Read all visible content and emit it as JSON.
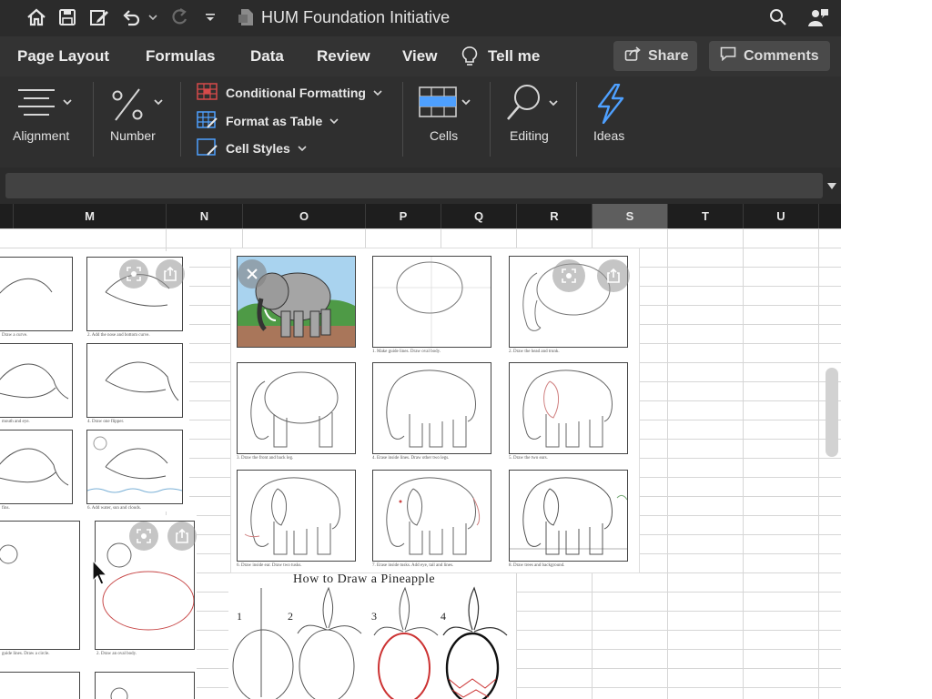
{
  "window": {
    "title": "HUM Foundation Initiative"
  },
  "tabs": [
    "Page Layout",
    "Formulas",
    "Data",
    "Review",
    "View",
    "Tell me"
  ],
  "header_buttons": {
    "share": "Share",
    "comments": "Comments"
  },
  "ribbon": {
    "alignment": "Alignment",
    "number": "Number",
    "styles": [
      "Conditional Formatting",
      "Format as Table",
      "Cell Styles"
    ],
    "cells": "Cells",
    "editing": "Editing",
    "ideas": "Ideas"
  },
  "formula_bar": {
    "value": ""
  },
  "columns": [
    "M",
    "N",
    "O",
    "P",
    "Q",
    "R",
    "S",
    "T",
    "U"
  ],
  "selected_column": "S",
  "pineapple": {
    "title": "How to Draw a Pineapple",
    "steps": [
      "1",
      "2",
      "3",
      "4"
    ]
  },
  "elephant_captions": [
    "1. Make guide lines. Draw oval body.",
    "2. Draw the head and trunk.",
    "3. Draw the front and back leg.",
    "4. Erase inside lines. Draw other two legs.",
    "5. Draw the two ears.",
    "6. Draw inside ear. Draw two tusks.",
    "7. Erase inside tusks. Add eye, tail and lines.",
    "8. Draw trees and background."
  ],
  "dolphin_captions": [
    "Draw a curve.",
    "2. Add the nose and bottom curve.",
    "mouth and eye.",
    "4. Draw one flipper.",
    "fins.",
    "6. Add water, sun and clouds."
  ],
  "circle_captions": [
    "guide lines. Draw a circle.",
    "2. Draw an oval body."
  ],
  "colors": {
    "title_bg": "#2b2b2b",
    "tabs_bg": "#333333",
    "ribbon_bg": "#2f2f2f",
    "accent_blue": "#4ea0ff",
    "selected_col": "#5e5e5e"
  }
}
